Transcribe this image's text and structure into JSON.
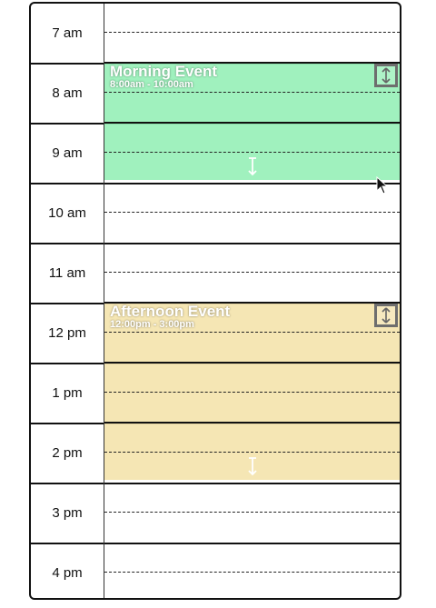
{
  "hours": [
    "7 am",
    "8 am",
    "9 am",
    "10 am",
    "11 am",
    "12 pm",
    "1 pm",
    "2 pm",
    "3 pm",
    "4 pm"
  ],
  "events": [
    {
      "title": "Morning Event",
      "time_range": "8:00am - 10:00am",
      "color": "#9ef0ba",
      "start_hour_index": 1,
      "duration_hours": 2
    },
    {
      "title": "Afternoon Event",
      "time_range": "12:00pm - 3:00pm",
      "color": "#f4e4ae",
      "start_hour_index": 5,
      "duration_hours": 3
    }
  ],
  "icons": {
    "move_handle": "vertical-arrows-icon",
    "resize_handle": "resize-vertical-icon",
    "cursor": "mouse-pointer-icon"
  }
}
